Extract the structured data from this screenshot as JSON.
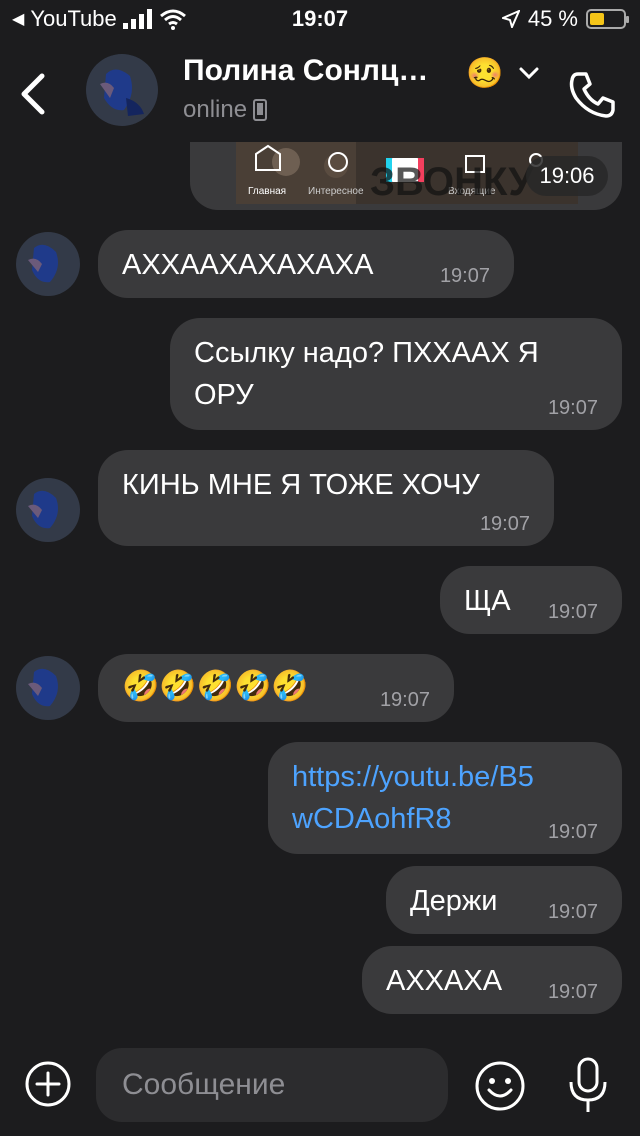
{
  "status_bar": {
    "back_app": "YouTube",
    "time": "19:07",
    "battery": "45 %",
    "battery_level_percent": 45
  },
  "header": {
    "contact_name": "Полина Сонлц…",
    "contact_emoji": "🥴",
    "status": "online"
  },
  "chat": {
    "media_time": "19:06",
    "media_caption_fragments": [
      "Главная",
      "Интересное",
      "Входящие",
      "ЗВОНКУ"
    ],
    "messages": [
      {
        "side": "in",
        "text": "АХХААХАХАХАХА",
        "time": "19:07"
      },
      {
        "side": "out",
        "text": "Ссылку надо? ПХХААХ Я ОРУ",
        "time": "19:07"
      },
      {
        "side": "in",
        "text": "КИНЬ МНЕ Я ТОЖЕ ХОЧУ",
        "time": "19:07"
      },
      {
        "side": "out",
        "text": "ЩА",
        "time": "19:07"
      },
      {
        "side": "in",
        "text": "🤣🤣🤣🤣🤣",
        "time": "19:07"
      },
      {
        "side": "out",
        "text": "https://youtu.be/B5wCDAohfR8",
        "time": "19:07",
        "is_link": true
      },
      {
        "side": "out",
        "text": "Держи",
        "time": "19:07"
      },
      {
        "side": "out",
        "text": "АХХАХА",
        "time": "19:07"
      }
    ]
  },
  "input": {
    "placeholder": "Сообщение"
  },
  "colors": {
    "background": "#1c1c1e",
    "bubble": "#3a3a3c",
    "link": "#4da3ff",
    "battery_fill": "#f5c518"
  },
  "icons": [
    "back-arrow-icon",
    "chevron-down-icon",
    "phone-icon",
    "phone-device-icon",
    "plus-circle-icon",
    "smile-icon",
    "microphone-icon",
    "signal-icon",
    "wifi-icon",
    "location-arrow-icon"
  ]
}
